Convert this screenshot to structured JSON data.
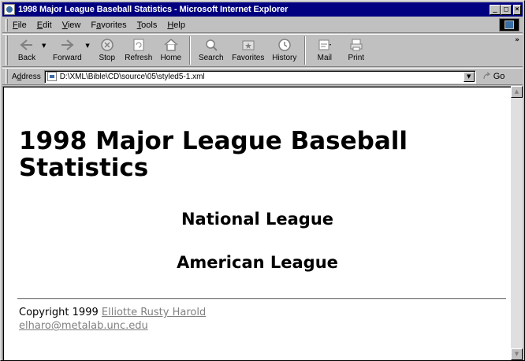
{
  "window": {
    "title": "1998 Major League Baseball Statistics - Microsoft Internet Explorer"
  },
  "menu": {
    "items": [
      {
        "accel": "F",
        "rest": "ile"
      },
      {
        "accel": "E",
        "rest": "dit"
      },
      {
        "accel": "V",
        "rest": "iew"
      },
      {
        "pre": "F",
        "accel": "a",
        "rest": "vorites"
      },
      {
        "accel": "T",
        "rest": "ools"
      },
      {
        "accel": "H",
        "rest": "elp"
      }
    ]
  },
  "toolbar": {
    "back": "Back",
    "forward": "Forward",
    "stop": "Stop",
    "refresh": "Refresh",
    "home": "Home",
    "search": "Search",
    "favorites": "Favorites",
    "history": "History",
    "mail": "Mail",
    "print": "Print"
  },
  "address": {
    "label_accel": "d",
    "label_pre": "A",
    "label_rest": "dress",
    "value": "D:\\XML\\Bible\\CD\\source\\05\\styled5-1.xml",
    "go": "Go"
  },
  "page": {
    "title": "1998 Major League Baseball Statistics",
    "leagues": [
      "National League",
      "American League"
    ],
    "copyright": "Copyright 1999",
    "author": "Elliotte Rusty Harold",
    "email": "elharo@metalab.unc.edu"
  },
  "colors": {
    "titlebar": "#000080",
    "chrome": "#c0c0c0",
    "link": "#808080"
  }
}
